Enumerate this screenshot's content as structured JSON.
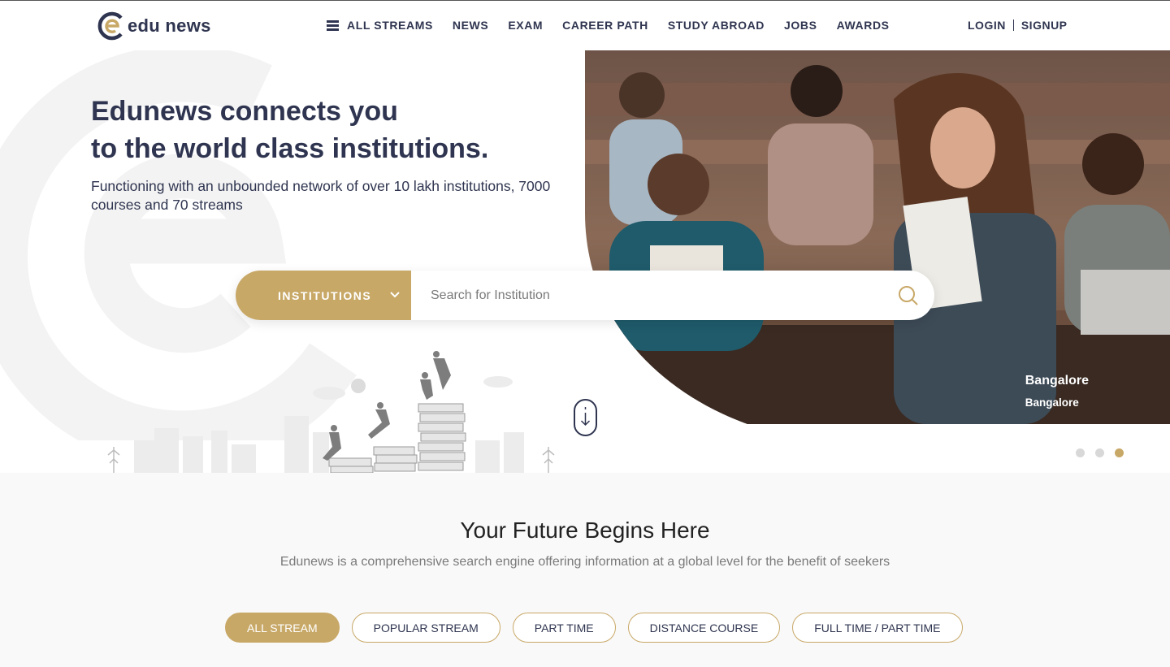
{
  "brand": {
    "name": "edu news",
    "accent": "#c8a867",
    "navy": "#2f3550"
  },
  "nav": {
    "items": [
      {
        "label": "ALL STREAMS",
        "icon": "hamburger-icon"
      },
      {
        "label": "NEWS"
      },
      {
        "label": "EXAM"
      },
      {
        "label": "CAREER PATH"
      },
      {
        "label": "STUDY ABROAD"
      },
      {
        "label": "JOBS"
      },
      {
        "label": "AWARDS"
      }
    ],
    "login": "LOGIN",
    "signup": "SIGNUP"
  },
  "hero": {
    "title_line1": "Edunews connects you",
    "title_line2": "to the world class institutions.",
    "subtitle": "Functioning with an unbounded network of over 10 lakh institutions, 7000 courses and 70 streams",
    "search": {
      "category": "INSTITUTIONS",
      "placeholder": "Search for Institution"
    },
    "slide": {
      "city": "Bangalore",
      "city_sub": "Bangalore"
    },
    "slider_dots": {
      "count": 3,
      "active": 3
    }
  },
  "future": {
    "title": "Your Future Begins Here",
    "subtitle": "Edunews is a comprehensive search engine offering information at a global level for the benefit of seekers",
    "tabs": [
      {
        "label": "ALL STREAM",
        "active": true
      },
      {
        "label": "POPULAR STREAM",
        "active": false
      },
      {
        "label": "PART TIME",
        "active": false
      },
      {
        "label": "DISTANCE COURSE",
        "active": false
      },
      {
        "label": "FULL TIME / PART TIME",
        "active": false
      }
    ]
  }
}
